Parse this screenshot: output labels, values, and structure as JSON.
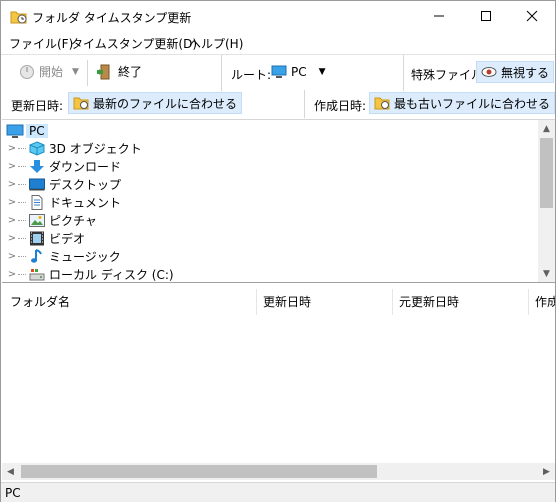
{
  "window": {
    "title": "フォルダ タイムスタンプ更新"
  },
  "menu": [
    {
      "label": "ファイル(F)"
    },
    {
      "label": "タイムスタンプ更新(D)"
    },
    {
      "label": "ヘルプ(H)"
    }
  ],
  "toolbar": {
    "start_label": "開始",
    "exit_label": "終了",
    "root_label": "ルート:",
    "root_value": "PC",
    "special_files_label": "特殊ファイル:",
    "ignore_label": "無視する",
    "modified_label": "更新日時:",
    "modified_value": "最新のファイルに合わせる",
    "created_label": "作成日時:",
    "created_value": "最も古いファイルに合わせる"
  },
  "tree": {
    "root": "PC",
    "items": [
      {
        "label": "3D オブジェクト",
        "icon": "3d-objects-icon"
      },
      {
        "label": "ダウンロード",
        "icon": "download-icon"
      },
      {
        "label": "デスクトップ",
        "icon": "desktop-icon"
      },
      {
        "label": "ドキュメント",
        "icon": "document-icon"
      },
      {
        "label": "ピクチャ",
        "icon": "picture-icon"
      },
      {
        "label": "ビデオ",
        "icon": "video-icon"
      },
      {
        "label": "ミュージック",
        "icon": "music-icon"
      },
      {
        "label": "ローカル ディスク (C:)",
        "icon": "local-disk-icon"
      }
    ]
  },
  "list": {
    "columns": [
      "フォルダ名",
      "更新日時",
      "元更新日時",
      "作成"
    ]
  },
  "status": {
    "text": "PC"
  }
}
